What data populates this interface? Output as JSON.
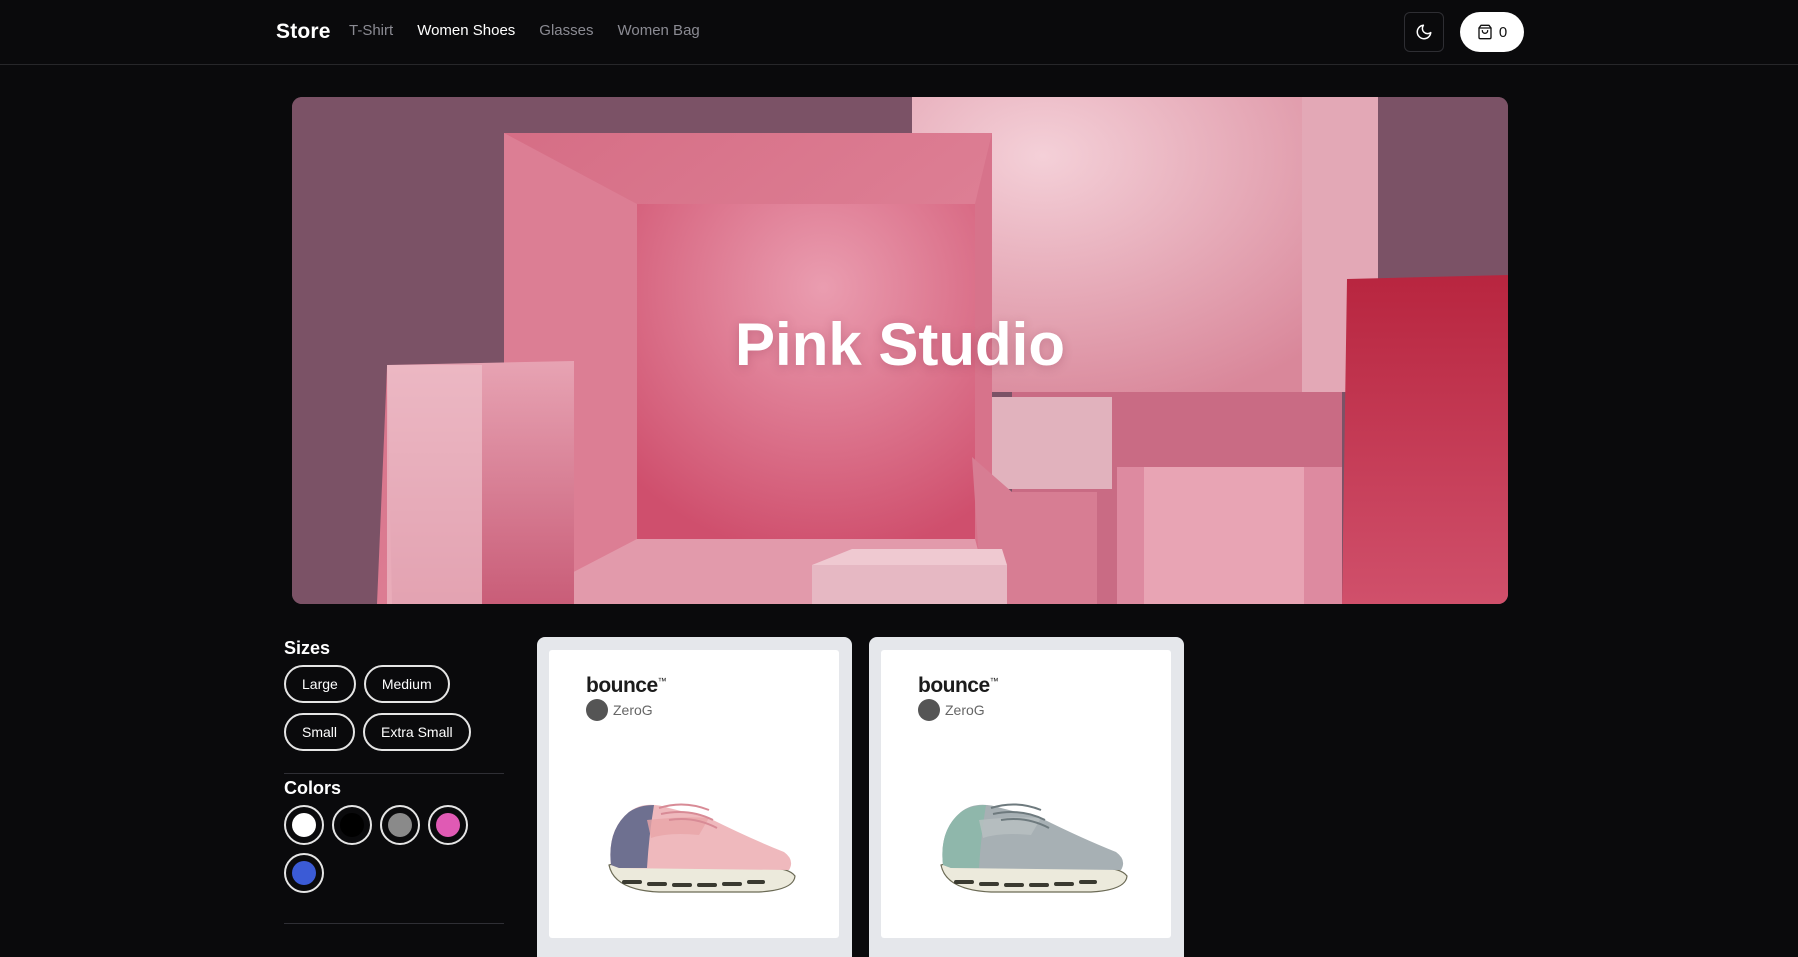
{
  "header": {
    "logo": "Store",
    "nav": [
      {
        "label": "T-Shirt",
        "active": false
      },
      {
        "label": "Women Shoes",
        "active": true
      },
      {
        "label": "Glasses",
        "active": false
      },
      {
        "label": "Women Bag",
        "active": false
      }
    ],
    "theme_icon": "moon-icon",
    "cart": {
      "icon": "shopping-bag-icon",
      "count": "0"
    }
  },
  "hero": {
    "title": "Pink Studio"
  },
  "filters": {
    "sizes_title": "Sizes",
    "sizes": [
      "Large",
      "Medium",
      "Small",
      "Extra Small"
    ],
    "colors_title": "Colors",
    "colors": [
      "#ffffff",
      "#000000",
      "#8a8a8a",
      "#e05ab4",
      "#3b5bd6"
    ]
  },
  "products": [
    {
      "brand": "bounce",
      "sub_brand": "ZeroG",
      "shoe_color": "pink"
    },
    {
      "brand": "bounce",
      "sub_brand": "ZeroG",
      "shoe_color": "sage"
    }
  ]
}
